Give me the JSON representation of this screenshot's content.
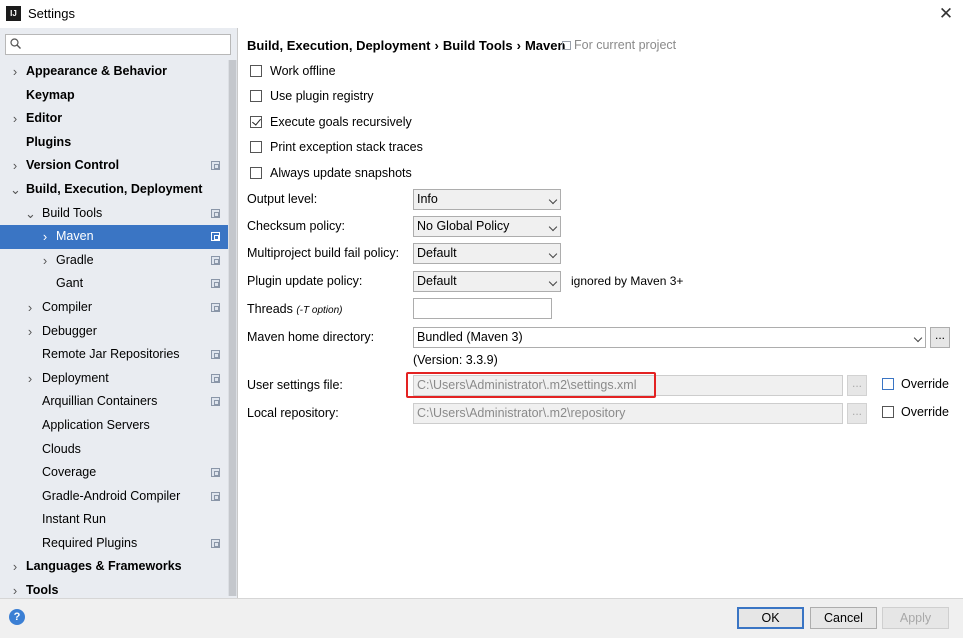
{
  "window": {
    "title": "Settings",
    "app_icon": "IJ"
  },
  "search": {
    "placeholder": ""
  },
  "sidebar": {
    "items": [
      {
        "label": "Appearance & Behavior",
        "level": 0,
        "arrow": "›",
        "proj": false
      },
      {
        "label": "Keymap",
        "level": 0,
        "arrow": "",
        "proj": false
      },
      {
        "label": "Editor",
        "level": 0,
        "arrow": "›",
        "proj": false
      },
      {
        "label": "Plugins",
        "level": 0,
        "arrow": "",
        "proj": false
      },
      {
        "label": "Version Control",
        "level": 0,
        "arrow": "›",
        "proj": true
      },
      {
        "label": "Build, Execution, Deployment",
        "level": 0,
        "arrow": "⌄",
        "proj": false
      },
      {
        "label": "Build Tools",
        "level": 1,
        "arrow": "⌄",
        "proj": true
      },
      {
        "label": "Maven",
        "level": 2,
        "arrow": "›",
        "proj": true,
        "selected": true
      },
      {
        "label": "Gradle",
        "level": 2,
        "arrow": "›",
        "proj": true
      },
      {
        "label": "Gant",
        "level": 2,
        "arrow": "",
        "proj": true
      },
      {
        "label": "Compiler",
        "level": 1,
        "arrow": "›",
        "proj": true
      },
      {
        "label": "Debugger",
        "level": 1,
        "arrow": "›",
        "proj": false
      },
      {
        "label": "Remote Jar Repositories",
        "level": 1,
        "arrow": "",
        "proj": true
      },
      {
        "label": "Deployment",
        "level": 1,
        "arrow": "›",
        "proj": true
      },
      {
        "label": "Arquillian Containers",
        "level": 1,
        "arrow": "",
        "proj": true
      },
      {
        "label": "Application Servers",
        "level": 1,
        "arrow": "",
        "proj": false
      },
      {
        "label": "Clouds",
        "level": 1,
        "arrow": "",
        "proj": false
      },
      {
        "label": "Coverage",
        "level": 1,
        "arrow": "",
        "proj": true
      },
      {
        "label": "Gradle-Android Compiler",
        "level": 1,
        "arrow": "",
        "proj": true
      },
      {
        "label": "Instant Run",
        "level": 1,
        "arrow": "",
        "proj": false
      },
      {
        "label": "Required Plugins",
        "level": 1,
        "arrow": "",
        "proj": true
      },
      {
        "label": "Languages & Frameworks",
        "level": 0,
        "arrow": "›",
        "proj": false
      },
      {
        "label": "Tools",
        "level": 0,
        "arrow": "›",
        "proj": false
      }
    ]
  },
  "breadcrumb": {
    "parts": [
      "Build, Execution, Deployment",
      "Build Tools",
      "Maven"
    ],
    "sep": "›",
    "note": "For current project"
  },
  "checkboxes": [
    {
      "label": "Work offline",
      "checked": false
    },
    {
      "label": "Use plugin registry",
      "checked": false
    },
    {
      "label": "Execute goals recursively",
      "checked": true
    },
    {
      "label": "Print exception stack traces",
      "checked": false
    },
    {
      "label": "Always update snapshots",
      "checked": false
    }
  ],
  "form": {
    "output_level": {
      "label": "Output level:",
      "value": "Info"
    },
    "checksum_policy": {
      "label": "Checksum policy:",
      "value": "No Global Policy"
    },
    "multiproject_fail": {
      "label": "Multiproject build fail policy:",
      "value": "Default"
    },
    "plugin_update": {
      "label": "Plugin update policy:",
      "value": "Default",
      "hint": "ignored by Maven 3+"
    },
    "threads": {
      "label": "Threads",
      "hint": "(-T option)",
      "value": ""
    },
    "maven_home": {
      "label": "Maven home directory:",
      "value": "Bundled (Maven 3)",
      "version": "(Version: 3.3.9)"
    },
    "user_settings": {
      "label": "User settings file:",
      "value": "C:\\Users\\Administrator\\.m2\\settings.xml",
      "override": "Override"
    },
    "local_repo": {
      "label": "Local repository:",
      "value": "C:\\Users\\Administrator\\.m2\\repository",
      "override": "Override"
    },
    "browse": "..."
  },
  "buttons": {
    "ok": "OK",
    "cancel": "Cancel",
    "apply": "Apply",
    "help": "?"
  },
  "colors": {
    "selection": "#3a75c4",
    "highlight": "#e32222"
  }
}
